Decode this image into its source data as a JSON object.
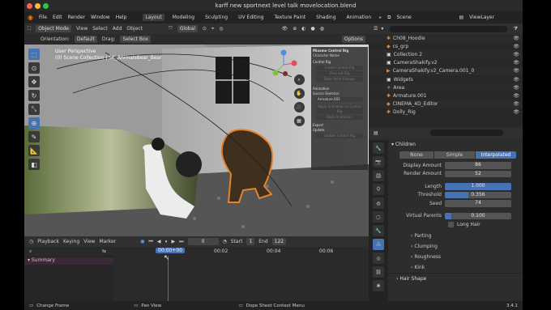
{
  "window": {
    "title": "karff  new sportnext level talk movelocation.blend"
  },
  "menu": {
    "items": [
      "File",
      "Edit",
      "Render",
      "Window",
      "Help"
    ],
    "workspaces": [
      "Layout",
      "Modeling",
      "Sculpting",
      "UV Editing",
      "Texture Paint",
      "Shading",
      "Animation"
    ],
    "scene": "Scene",
    "viewlayer": "ViewLayer"
  },
  "viewport": {
    "mode": "Object Mode",
    "view": "View",
    "select": "Select",
    "add": "Add",
    "object": "Object",
    "transform": "Global",
    "orientation_label": "Orientation:",
    "orientation": "Default",
    "drag_label": "Drag:",
    "drag": "Select Box",
    "options": "Options",
    "info_line1": "User Perspective",
    "info_line2": "(0) Scene Collection | SK_AnimalsBear_Bear"
  },
  "rig_panel": {
    "title": "Mixamo Control Rig",
    "character_name": "Character Name",
    "control_rig": "Control Rig",
    "create": "Create Control Rig",
    "zero_out": "Zero out Rig",
    "bake": "Bake Anim Change",
    "animation": "Animation",
    "source": "Source Skeleton:",
    "armature": "Armature.002",
    "apply": "Apply Animation to Control Rig",
    "bake_anim": "Bake Animation",
    "export": "Export",
    "update": "Update",
    "update_btn": "Update Control Rig"
  },
  "timeline": {
    "playback": "Playback",
    "keying": "Keying",
    "view": "View",
    "marker": "Marker",
    "current": "0",
    "start_label": "Start",
    "start": "1",
    "end_label": "End",
    "end": "122",
    "timecode": "00:00+00",
    "ticks": [
      "00:02",
      "00:04",
      "00:06"
    ],
    "summary": "Summary"
  },
  "status": {
    "left": "Change Frame",
    "mid": "Pan View",
    "right": "Dope Sheet Context Menu",
    "version": "3.4.1"
  },
  "outliner": {
    "rows": [
      {
        "name": "Ch08_Hoodie"
      },
      {
        "name": "cs_grp"
      },
      {
        "name": "Collection 2"
      },
      {
        "name": "CameraShakify.v2"
      },
      {
        "name": "CameraShakify.v2_Camera.001_0"
      },
      {
        "name": "Widgets"
      },
      {
        "name": "Area"
      },
      {
        "name": "Armature.001"
      },
      {
        "name": "CINEMA_4D_Editor"
      },
      {
        "name": "Dolly_Rig"
      }
    ]
  },
  "properties": {
    "section": "Children",
    "modes": [
      "None",
      "Simple",
      "Interpolated"
    ],
    "active_mode": "Interpolated",
    "rows": [
      {
        "label": "Display Amount",
        "value": "86",
        "fill": 0
      },
      {
        "label": "Render Amount",
        "value": "52",
        "fill": 0
      },
      {
        "label": "Length",
        "value": "1.000",
        "fill": 1.0
      },
      {
        "label": "Threshold",
        "value": "0.356",
        "fill": 0.356
      },
      {
        "label": "Seed",
        "value": "74",
        "fill": 0
      },
      {
        "label": "Virtual Parents",
        "value": "0.100",
        "fill": 0.1
      }
    ],
    "long_hair": "Long Hair",
    "subs": [
      "Parting",
      "Clumping",
      "Roughness",
      "Kink"
    ],
    "hair_shape": "Hair Shape"
  },
  "colors": {
    "accent": "#4772b3",
    "selection": "#e8822a"
  }
}
